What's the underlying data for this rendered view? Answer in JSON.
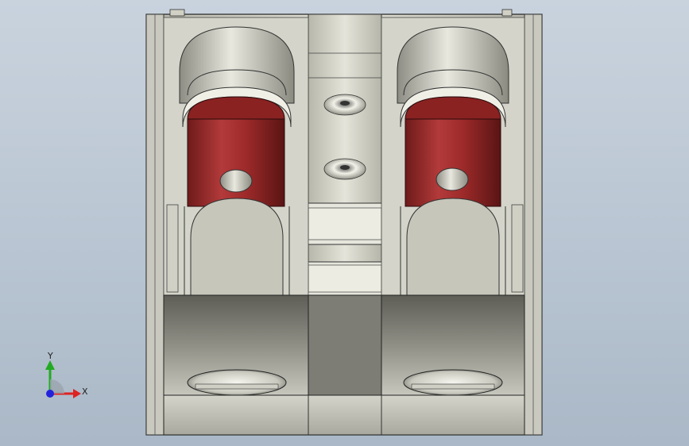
{
  "viewport": {
    "background_top": "#c9d3de",
    "background_bottom": "#aab8c7"
  },
  "model": {
    "body_color": "#d8d8cc",
    "shade_color": "#8f8f86",
    "dark_color": "#3a3a36",
    "cylinder_color": "#9e2a2a"
  },
  "triad": {
    "y_label": "Y",
    "x_label": "X",
    "y_color": "#22aa22",
    "x_color": "#dd2222",
    "z_color": "#2222dd"
  }
}
